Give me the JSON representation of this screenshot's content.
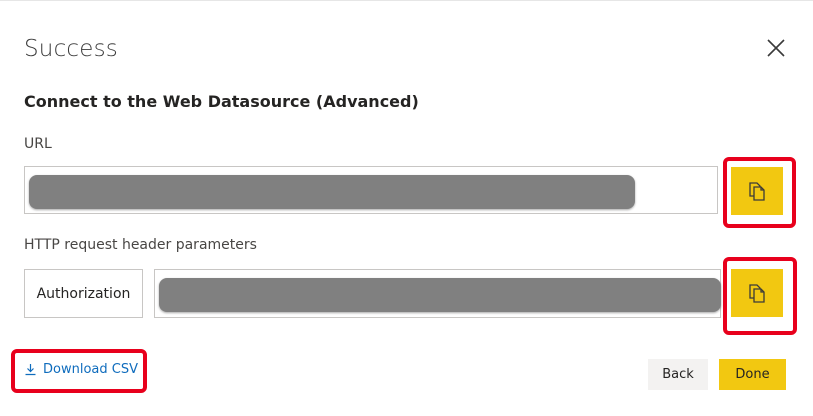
{
  "dialog": {
    "title": "Success",
    "subtitle": "Connect to the Web Datasource (Advanced)"
  },
  "url": {
    "label": "URL",
    "value_redacted": true
  },
  "headers": {
    "label": "HTTP request header parameters",
    "rows": [
      {
        "key": "Authorization",
        "value_redacted": true
      }
    ]
  },
  "footer": {
    "download_label": "Download CSV",
    "back_label": "Back",
    "done_label": "Done"
  },
  "icons": {
    "close": "close-icon",
    "copy": "copy-icon",
    "download": "download-icon"
  },
  "colors": {
    "accent": "#f2c811",
    "link": "#0f6cbd",
    "highlight": "#e8001c",
    "redaction": "#808080"
  }
}
